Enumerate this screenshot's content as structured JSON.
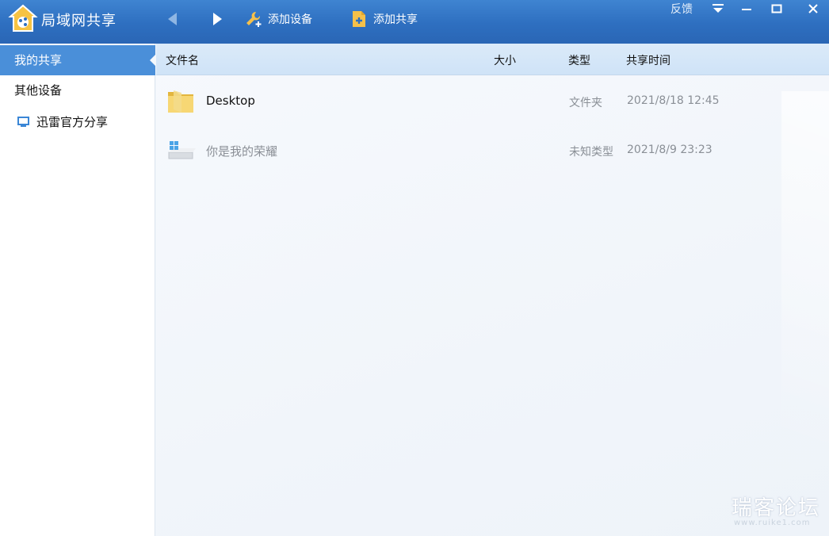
{
  "app": {
    "title": "局域网共享"
  },
  "toolbar": {
    "add_device_label": "添加设备",
    "add_share_label": "添加共享",
    "feedback_label": "反馈"
  },
  "sidebar": {
    "items": [
      {
        "label": "我的共享",
        "active": true
      },
      {
        "label": "其他设备",
        "active": false
      },
      {
        "label": "迅雷官方分享",
        "active": false,
        "icon": "monitor-icon"
      }
    ]
  },
  "table": {
    "columns": [
      "文件名",
      "大小",
      "类型",
      "共享时间"
    ],
    "rows": [
      {
        "name": "Desktop",
        "size": "",
        "type": "文件夹",
        "time": "2021/8/18 12:45",
        "icon": "folder-icon"
      },
      {
        "name": "你是我的荣耀",
        "size": "",
        "type": "未知类型",
        "time": "2021/8/9 23:23",
        "icon": "drive-icon"
      }
    ]
  },
  "watermark": {
    "text": "瑞客论坛",
    "url": "www.ruike1.com"
  },
  "colors": {
    "titlebar": "#2e6fc0",
    "active_item": "#4a8fd9",
    "header": "#d4e6f8"
  }
}
